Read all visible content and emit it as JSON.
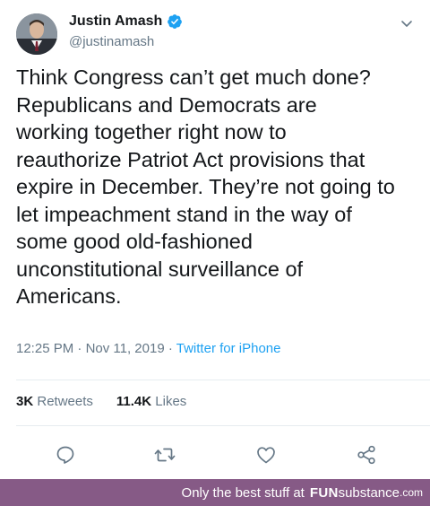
{
  "tweet": {
    "author_name": "Justin Amash",
    "handle": "@justinamash",
    "text": "Think Congress can’t get much done?\nRepublicans and Democrats are\nworking together right now to\nreauthorize Patriot Act provisions that\nexpire in December. They’re not going to\nlet impeachment stand in the way of\nsome good old-fashioned\nunconstitutional surveillance of\nAmericans.",
    "time": "12:25 PM",
    "date": "Nov 11, 2019",
    "separator": "·",
    "source": "Twitter for iPhone",
    "retweets_count": "3K",
    "retweets_label": "Retweets",
    "likes_count": "11.4K",
    "likes_label": "Likes"
  },
  "icons": {
    "verified": "verified-badge-icon",
    "menu": "chevron-down-icon",
    "reply": "reply-icon",
    "retweet": "retweet-icon",
    "like": "heart-icon",
    "share": "share-icon"
  },
  "colors": {
    "text": "#14171a",
    "secondary": "#657786",
    "link": "#1da1f2",
    "footer_bg": "#865a86"
  },
  "footer": {
    "tagline": "Only the best stuff at",
    "brand_fun": "FUN",
    "brand_substance": "substance",
    "brand_tld": ".com"
  }
}
